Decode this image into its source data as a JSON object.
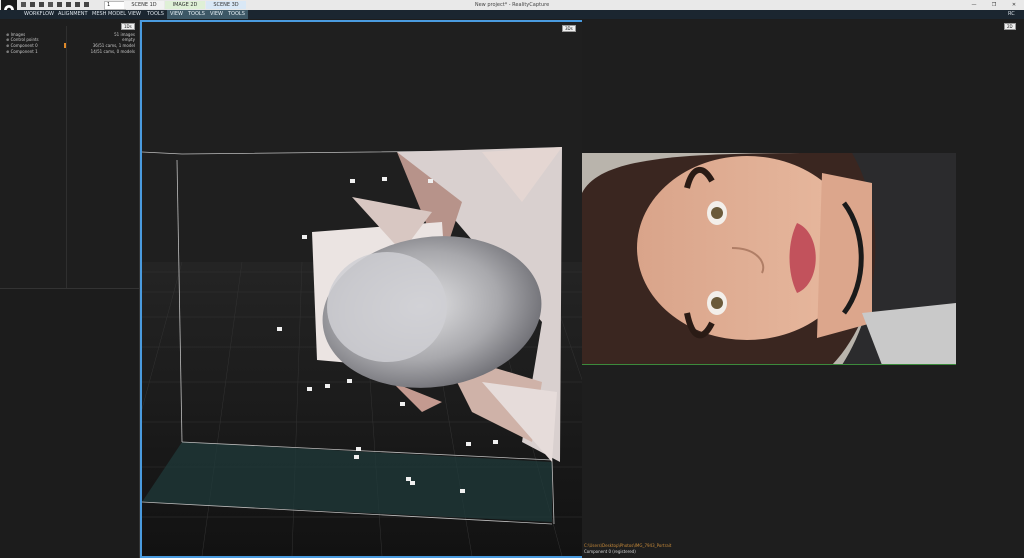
{
  "window": {
    "title": "New project* - RealityCapture",
    "controls": {
      "minimize": "—",
      "restore": "❐",
      "close": "✕"
    }
  },
  "quick_toolbar": {
    "field_value": "1"
  },
  "tabs": [
    {
      "label": "SCENE 1D",
      "bg": "#f2f2f2"
    },
    {
      "label": "IMAGE 2D",
      "bg": "#dff0d6"
    },
    {
      "label": "SCENE 3D",
      "bg": "#d9e8f6"
    }
  ],
  "menu": {
    "items": [
      "WORKFLOW",
      "ALIGNMENT",
      "MESH MODEL",
      "VIEW",
      "TOOLS"
    ],
    "sub_2d": [
      "VIEW",
      "TOOLS"
    ],
    "sub_3d": [
      "VIEW",
      "TOOLS"
    ],
    "right_badge": "RC"
  },
  "panel_1d": {
    "badge": "1Ds",
    "tree": [
      {
        "label": "Images",
        "value": "51 images"
      },
      {
        "label": "Control points",
        "value": "empty"
      },
      {
        "label": "Component 0",
        "value": "36/51 cams, 1 model"
      },
      {
        "label": "Component 1",
        "value": "14/51 cams, 0 models"
      }
    ]
  },
  "panel_3d": {
    "badge": "3Ds"
  },
  "panel_2d": {
    "badge": "2D",
    "log": [
      {
        "text": "C:\\Users\\Desktop\\Photos\\IMG_7943_Portrait",
        "color": "#c78a3a"
      },
      {
        "text": "Component 0 (registered)",
        "color": "#d8d8d8"
      }
    ]
  },
  "colors": {
    "accent": "#4a9bdf",
    "menu_bg": "#1b2630",
    "panel_bg": "#1d1d1d"
  }
}
